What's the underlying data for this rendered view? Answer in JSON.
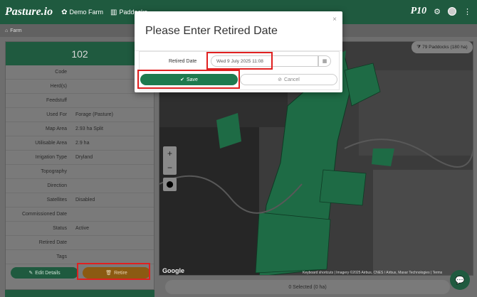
{
  "topbar": {
    "logo": "Pasture.io",
    "nav": [
      {
        "icon": "leaf-icon",
        "glyph": "✿",
        "label": "Demo Farm"
      },
      {
        "icon": "map-icon",
        "glyph": "▥",
        "label": "Paddocks"
      }
    ],
    "right": {
      "brand": "P10",
      "settings_icon": "gear-icon",
      "settings_glyph": "⚙",
      "avatar_icon": "avatar-icon",
      "menu_glyph": "⋮"
    }
  },
  "breadcrumb": {
    "home_glyph": "⌂",
    "label": "Farm"
  },
  "panel": {
    "title": "102",
    "rows": [
      {
        "key": "Code",
        "value": ""
      },
      {
        "key": "Herd(s)",
        "value": ""
      },
      {
        "key": "Feedstuff",
        "value": ""
      },
      {
        "key": "Used For",
        "value": "Forage (Pasture)"
      },
      {
        "key": "Map Area",
        "value": "2.93 ha Split"
      },
      {
        "key": "Utilisable Area",
        "value": "2.9 ha"
      },
      {
        "key": "Irrigation Type",
        "value": "Dryland"
      },
      {
        "key": "Topography",
        "value": ""
      },
      {
        "key": "Direction",
        "value": ""
      },
      {
        "key": "Satellites",
        "value": "Disabled"
      },
      {
        "key": "Commissioned Date",
        "value": ""
      },
      {
        "key": "Status",
        "value": "Active"
      },
      {
        "key": "Retired Date",
        "value": ""
      },
      {
        "key": "Tags",
        "value": ""
      }
    ],
    "edit_label": "Edit Details",
    "retire_label": "Retire"
  },
  "map": {
    "paddocks_label": "79 Paddocks (180 ha)",
    "zoom_in": "+",
    "zoom_out": "−",
    "google_label": "Google",
    "attribution": "Keyboard shortcuts | Imagery ©2025 Airbus, CNES / Airbus, Maxar Technologies | Terms",
    "selected_label": "0 Selected (0 ha)"
  },
  "modal": {
    "title": "Please Enter Retired Date",
    "close_glyph": "×",
    "field_label": "Retired Date",
    "field_value": "Wed 9 July 2025 11:08",
    "save_label": "Save",
    "cancel_label": "Cancel"
  },
  "colors": {
    "brand_green": "#1f5a3f",
    "save_green": "#1f7a4f",
    "retire_brown": "#8b5a12",
    "highlight_red": "#e02020"
  }
}
